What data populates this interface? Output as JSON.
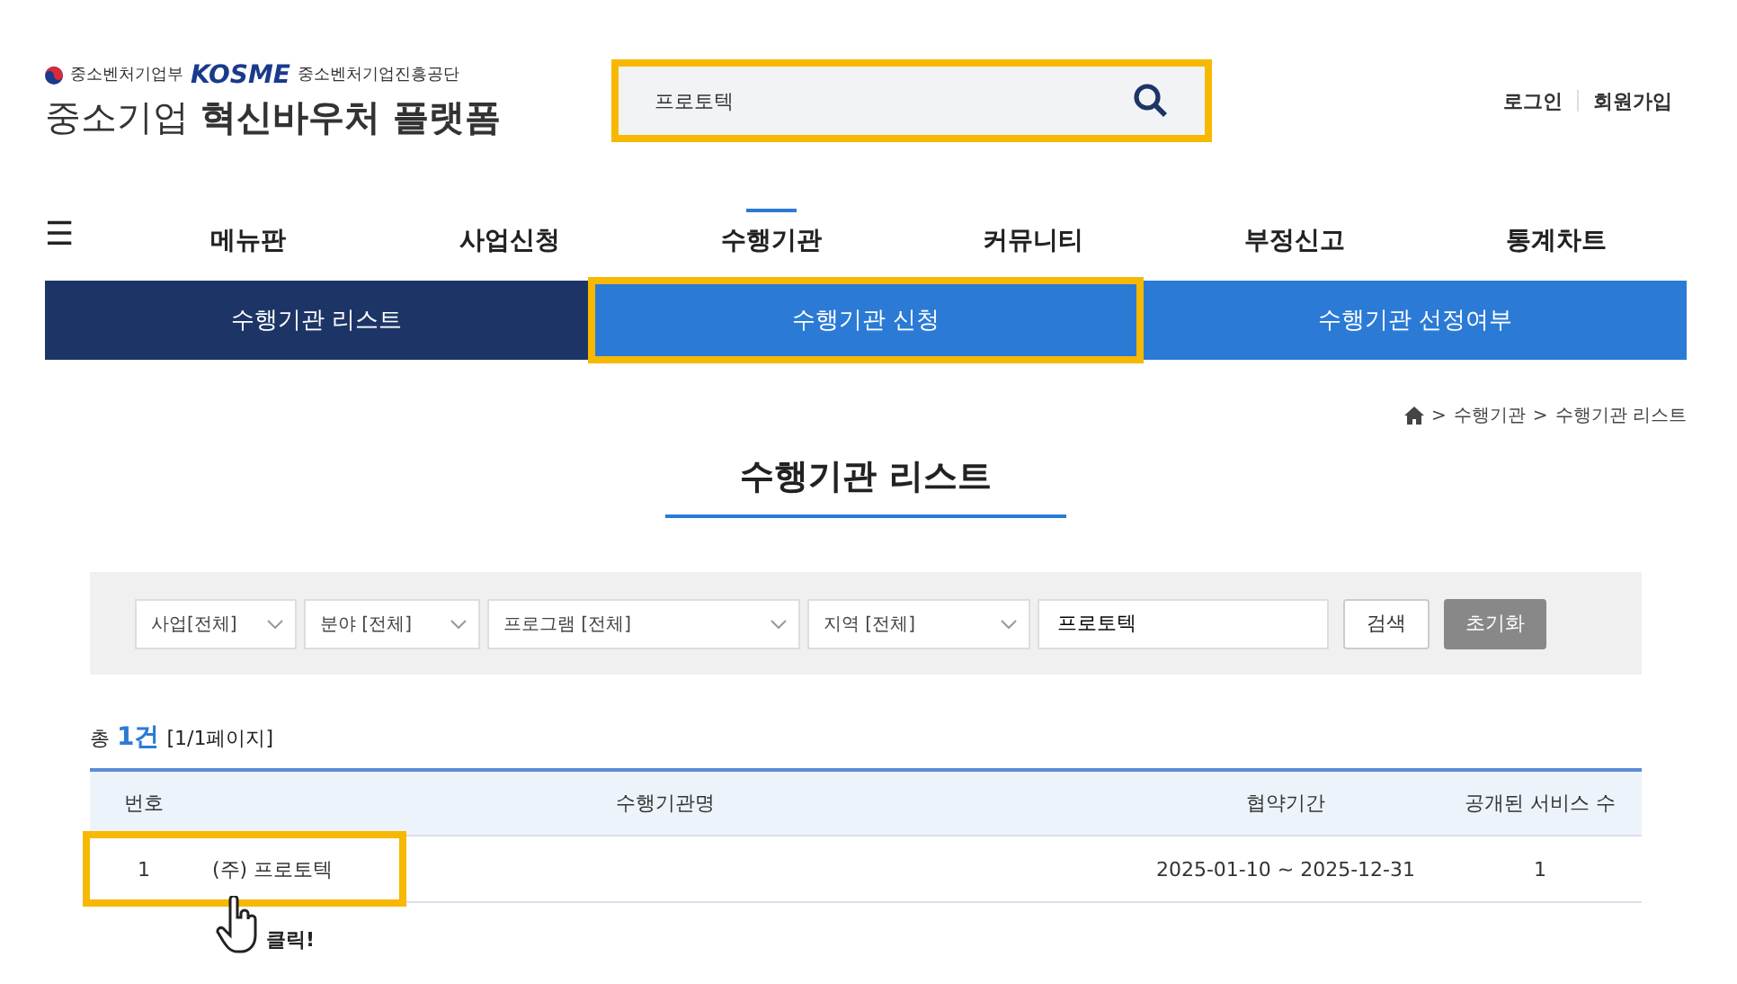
{
  "header": {
    "ministry": "중소벤처기업부",
    "agency_logo": "KOSME",
    "agency": "중소벤처기업진흥공단",
    "site_title_plain": "중소기업",
    "site_title_bold": "혁신바우처 플랫폼",
    "search": {
      "value": "프로토텍",
      "highlighted": true
    },
    "links": [
      "로그인",
      "회원가입"
    ]
  },
  "nav": {
    "menu_icon": "☰",
    "items": [
      {
        "label": "메뉴판",
        "selected": false
      },
      {
        "label": "사업신청",
        "selected": false
      },
      {
        "label": "수행기관",
        "selected": true
      },
      {
        "label": "커뮤니티",
        "selected": false
      },
      {
        "label": "부정신고",
        "selected": false
      },
      {
        "label": "통계차트",
        "selected": false
      }
    ]
  },
  "subnav": [
    {
      "label": "수행기관 리스트",
      "selected": true,
      "highlighted": false
    },
    {
      "label": "수행기관 신청",
      "selected": false,
      "highlighted": true
    },
    {
      "label": "수행기관 선정여부",
      "selected": false,
      "highlighted": false
    }
  ],
  "breadcrumb": {
    "separator": ">",
    "items": [
      "수행기관",
      "수행기관 리스트"
    ]
  },
  "page_title": "수행기관 리스트",
  "filters": {
    "selects": [
      "사업[전체]",
      "분야 [전체]",
      "프로그램 [전체]",
      "지역 [전체]"
    ],
    "keyword": "프로토텍",
    "search_button": "검색",
    "reset_button": "초기화"
  },
  "summary": {
    "prefix": "총",
    "count": "1건",
    "pages": "[1/1페이지]"
  },
  "table": {
    "columns": [
      "번호",
      "수행기관명",
      "협약기간",
      "공개된 서비스 수"
    ],
    "rows": [
      {
        "cells": [
          "1",
          "(주) 프로토텍",
          "2025-01-10 ~ 2025-12-31",
          "1"
        ],
        "highlighted": true
      }
    ]
  },
  "callout": {
    "text": "클릭!"
  }
}
